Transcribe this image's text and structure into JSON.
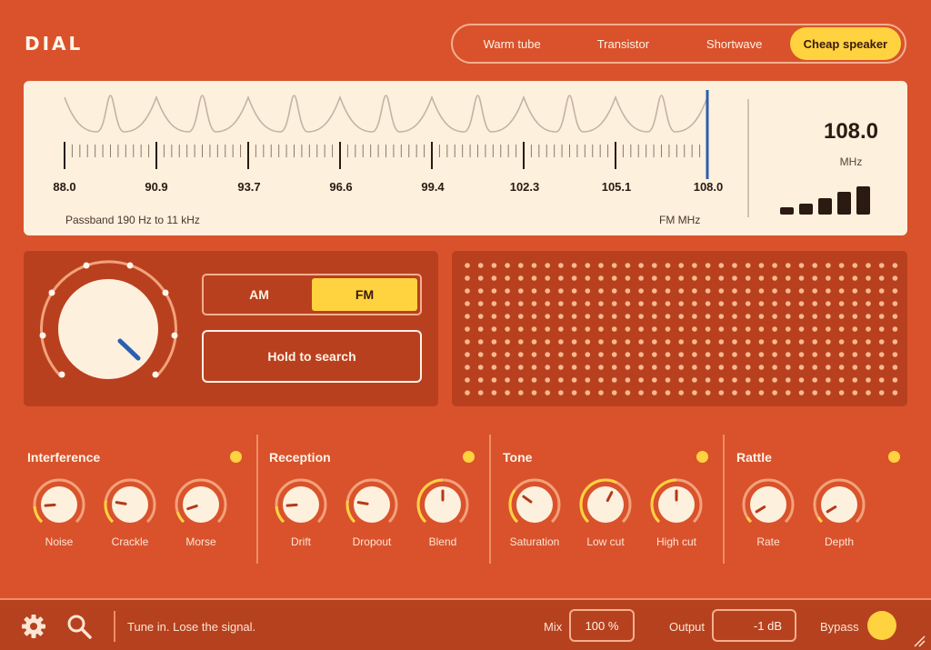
{
  "app": {
    "title": "DIAL"
  },
  "presets": [
    {
      "label": "Warm tube",
      "active": false
    },
    {
      "label": "Transistor",
      "active": false
    },
    {
      "label": "Shortwave",
      "active": false
    },
    {
      "label": "Cheap speaker",
      "active": true
    }
  ],
  "tuner": {
    "frequency": "108.0",
    "frequency_unit": "MHz",
    "ticks": [
      "88.0",
      "90.9",
      "93.7",
      "96.6",
      "99.4",
      "102.3",
      "105.1",
      "108.0"
    ],
    "passband": "Passband 190 Hz to 11 kHz",
    "band_unit": "FM  MHz",
    "signal_strength_bars": 5,
    "needle_position": 1.0
  },
  "mode": {
    "options": [
      "AM",
      "FM"
    ],
    "selected": "FM"
  },
  "search_button": "Hold to search",
  "sections": [
    {
      "title": "Interference",
      "knobs": [
        {
          "label": "Noise",
          "value": 0.15
        },
        {
          "label": "Crackle",
          "value": 0.2
        },
        {
          "label": "Morse",
          "value": 0.1
        }
      ]
    },
    {
      "title": "Reception",
      "knobs": [
        {
          "label": "Drift",
          "value": 0.15
        },
        {
          "label": "Dropout",
          "value": 0.2
        },
        {
          "label": "Blend",
          "value": 0.5
        }
      ]
    },
    {
      "title": "Tone",
      "knobs": [
        {
          "label": "Saturation",
          "value": 0.3
        },
        {
          "label": "Low cut",
          "value": 0.6
        },
        {
          "label": "High cut",
          "value": 0.5
        }
      ]
    },
    {
      "title": "Rattle",
      "knobs": [
        {
          "label": "Rate",
          "value": 0.05
        },
        {
          "label": "Depth",
          "value": 0.05
        }
      ]
    }
  ],
  "footer": {
    "status": "Tune in. Lose the signal.",
    "mix_label": "Mix",
    "mix_value": "100 %",
    "output_label": "Output",
    "output_value": "-1 dB",
    "bypass_label": "Bypass"
  },
  "colors": {
    "accent": "#ffd23f",
    "background": "#d9522c",
    "panel": "#b9401f",
    "needle": "#2b5fb0"
  }
}
